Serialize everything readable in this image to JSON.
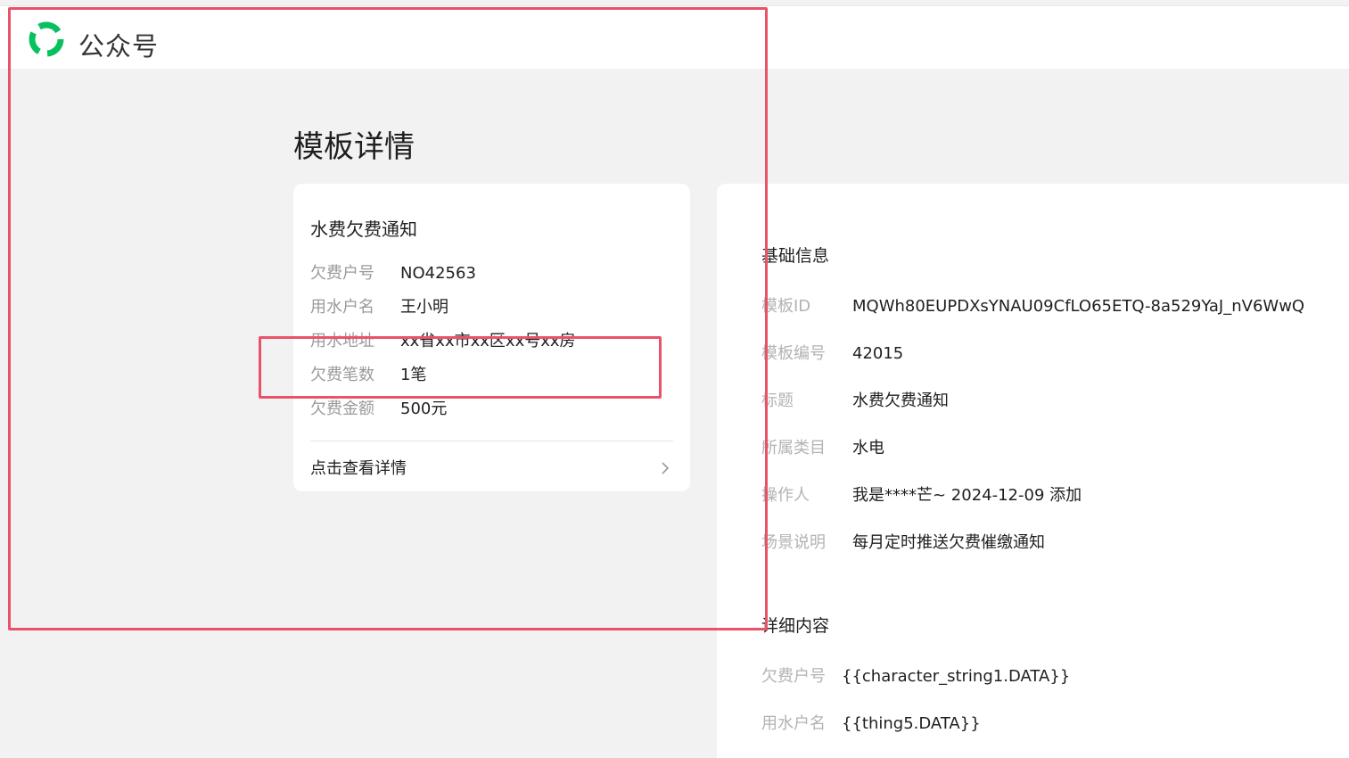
{
  "header": {
    "brand": "公众号",
    "logo_icon": "wechat-official-account-logo"
  },
  "page": {
    "title": "模板详情"
  },
  "preview": {
    "title": "水费欠费通知",
    "fields": [
      {
        "label": "欠费户号",
        "value": "NO42563"
      },
      {
        "label": "用水户名",
        "value": "王小明"
      },
      {
        "label": "用水地址",
        "value": "xx省xx市xx区xx号xx房"
      },
      {
        "label": "欠费笔数",
        "value": "1笔"
      },
      {
        "label": "欠费金额",
        "value": "500元"
      }
    ],
    "link": "点击查看详情",
    "link_icon": "chevron-right-icon"
  },
  "basic_info": {
    "title": "基础信息",
    "rows": [
      {
        "label": "模板ID",
        "value": "MQWh80EUPDXsYNAU09CfLO65ETQ-8a529YaJ_nV6WwQ"
      },
      {
        "label": "模板编号",
        "value": "42015"
      },
      {
        "label": "标题",
        "value": "水费欠费通知"
      },
      {
        "label": "所属类目",
        "value": "水电"
      },
      {
        "label": "操作人",
        "value": "我是****芒~ 2024-12-09 添加"
      },
      {
        "label": "场景说明",
        "value": "每月定时推送欠费催缴通知"
      }
    ]
  },
  "detail_content": {
    "title": "详细内容",
    "rows": [
      {
        "label": "欠费户号",
        "value": "{{character_string1.DATA}}"
      },
      {
        "label": "用水户名",
        "value": "{{thing5.DATA}}"
      }
    ]
  },
  "colors": {
    "accent_green": "#07c160",
    "highlight_red": "#e9536a",
    "background": "#f2f2f2"
  }
}
